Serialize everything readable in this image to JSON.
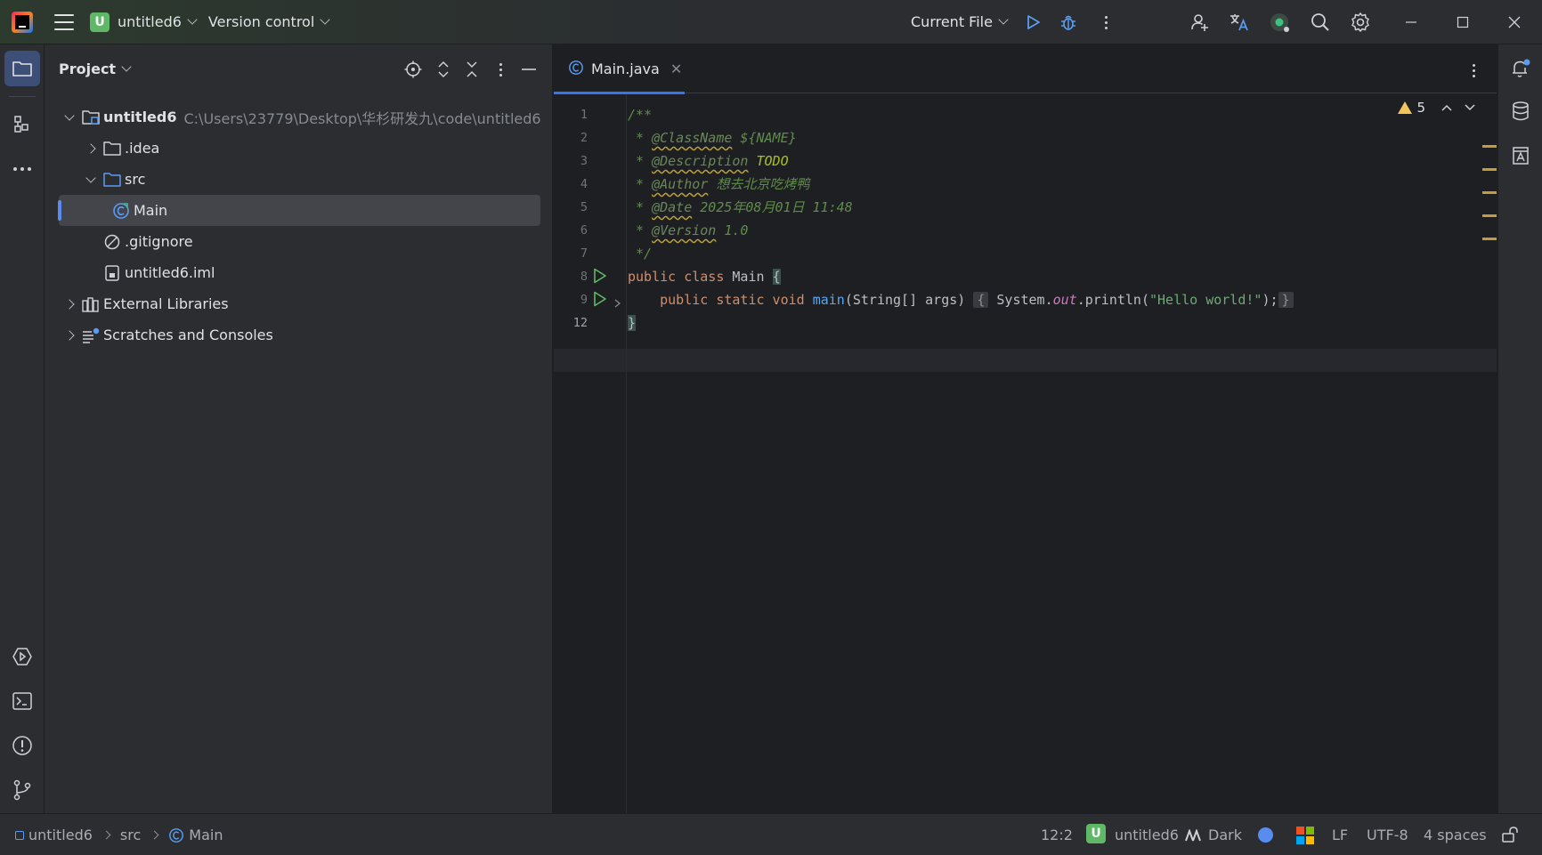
{
  "titlebar": {
    "project_initial": "U",
    "project_name": "untitled6",
    "vcs_label": "Version control",
    "run_config": "Current File"
  },
  "project_panel": {
    "title": "Project",
    "tree": [
      {
        "label": "untitled6",
        "path": "C:\\Users\\23779\\Desktop\\华杉研发九\\code\\untitled6"
      },
      {
        "label": ".idea"
      },
      {
        "label": "src"
      },
      {
        "label": "Main"
      },
      {
        "label": ".gitignore"
      },
      {
        "label": "untitled6.iml"
      },
      {
        "label": "External Libraries"
      },
      {
        "label": "Scratches and Consoles"
      }
    ]
  },
  "editor": {
    "tab_label": "Main.java",
    "warning_count": "5",
    "line_numbers": [
      "1",
      "2",
      "3",
      "4",
      "5",
      "6",
      "7",
      "8",
      "9",
      "12"
    ],
    "code": {
      "l1": "/**",
      "l2_prefix": " * ",
      "l2_tag": "@ClassName",
      "l2_val": " ${NAME}",
      "l3_tag": "@Description",
      "l3_val": " TODO",
      "l4_tag": "@Author",
      "l4_val": " 想去北京吃烤鸭",
      "l5_tag": "@Date",
      "l5_val": " 2025年08月01日 11:48",
      "l6_tag": "@Version",
      "l6_val": " 1.0",
      "l7": " */",
      "l8_kw": "public class",
      "l8_name": " Main ",
      "l8_brace": "{",
      "l9_kw": "    public static void",
      "l9_fn": "main",
      "l9_args": "(String[] args)",
      "l9_open": "{",
      "l9_sys": " System.",
      "l9_out": "out",
      "l9_print": ".println(",
      "l9_str": "\"Hello world!\"",
      "l9_end": ");",
      "l9_close": "}",
      "l12": "}"
    }
  },
  "statusbar": {
    "breadcrumb": [
      "untitled6",
      "src",
      "Main"
    ],
    "position": "12:2",
    "project_initial": "U",
    "project": "untitled6",
    "theme": "Dark",
    "line_sep": "LF",
    "encoding": "UTF-8",
    "indent": "4 spaces"
  },
  "colors": {
    "accent": "#3574f0",
    "project_badge": "#5fb865",
    "warning": "#f2c55c"
  }
}
